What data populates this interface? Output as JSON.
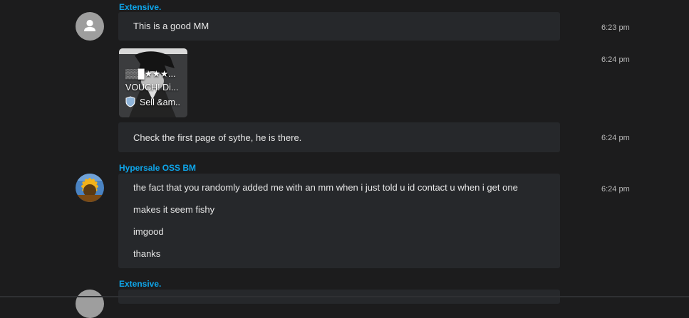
{
  "messages": {
    "group1": {
      "sender": "Extensive.",
      "text": "This is a good MM",
      "time": "6:23 pm"
    },
    "card": {
      "line1": "▒▒█★★★...",
      "line2": "VOUCH! Di...",
      "line3": "Sell &am..",
      "shield_icon": "shield-icon",
      "time": "6:24 pm"
    },
    "group1b": {
      "text": "Check the first page of sythe, he is there.",
      "time": "6:24 pm"
    },
    "group2": {
      "sender": "Hypersale OSS BM",
      "lines": [
        "the fact that you randomly added me with an mm when i just told u id contact u when i get one",
        "makes it seem fishy",
        "imgood",
        "thanks"
      ],
      "time": "6:24 pm"
    },
    "group3": {
      "sender": "Extensive."
    }
  },
  "colors": {
    "background": "#1c1c1d",
    "bubble": "#26282b",
    "sender": "#0ea5e9",
    "text": "#e7e7e7",
    "time": "#b9b9b9"
  }
}
